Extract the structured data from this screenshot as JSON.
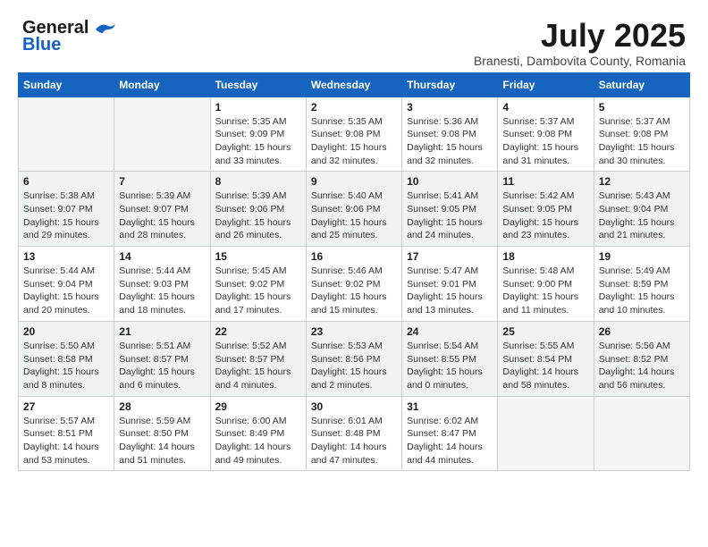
{
  "logo": {
    "line1": "General",
    "line2": "Blue"
  },
  "title": "July 2025",
  "subtitle": "Branesti, Dambovita County, Romania",
  "weekdays": [
    "Sunday",
    "Monday",
    "Tuesday",
    "Wednesday",
    "Thursday",
    "Friday",
    "Saturday"
  ],
  "weeks": [
    [
      {
        "day": "",
        "empty": true
      },
      {
        "day": "",
        "empty": true
      },
      {
        "day": "1",
        "sunrise": "Sunrise: 5:35 AM",
        "sunset": "Sunset: 9:09 PM",
        "daylight": "Daylight: 15 hours and 33 minutes."
      },
      {
        "day": "2",
        "sunrise": "Sunrise: 5:35 AM",
        "sunset": "Sunset: 9:08 PM",
        "daylight": "Daylight: 15 hours and 32 minutes."
      },
      {
        "day": "3",
        "sunrise": "Sunrise: 5:36 AM",
        "sunset": "Sunset: 9:08 PM",
        "daylight": "Daylight: 15 hours and 32 minutes."
      },
      {
        "day": "4",
        "sunrise": "Sunrise: 5:37 AM",
        "sunset": "Sunset: 9:08 PM",
        "daylight": "Daylight: 15 hours and 31 minutes."
      },
      {
        "day": "5",
        "sunrise": "Sunrise: 5:37 AM",
        "sunset": "Sunset: 9:08 PM",
        "daylight": "Daylight: 15 hours and 30 minutes."
      }
    ],
    [
      {
        "day": "6",
        "sunrise": "Sunrise: 5:38 AM",
        "sunset": "Sunset: 9:07 PM",
        "daylight": "Daylight: 15 hours and 29 minutes."
      },
      {
        "day": "7",
        "sunrise": "Sunrise: 5:39 AM",
        "sunset": "Sunset: 9:07 PM",
        "daylight": "Daylight: 15 hours and 28 minutes."
      },
      {
        "day": "8",
        "sunrise": "Sunrise: 5:39 AM",
        "sunset": "Sunset: 9:06 PM",
        "daylight": "Daylight: 15 hours and 26 minutes."
      },
      {
        "day": "9",
        "sunrise": "Sunrise: 5:40 AM",
        "sunset": "Sunset: 9:06 PM",
        "daylight": "Daylight: 15 hours and 25 minutes."
      },
      {
        "day": "10",
        "sunrise": "Sunrise: 5:41 AM",
        "sunset": "Sunset: 9:05 PM",
        "daylight": "Daylight: 15 hours and 24 minutes."
      },
      {
        "day": "11",
        "sunrise": "Sunrise: 5:42 AM",
        "sunset": "Sunset: 9:05 PM",
        "daylight": "Daylight: 15 hours and 23 minutes."
      },
      {
        "day": "12",
        "sunrise": "Sunrise: 5:43 AM",
        "sunset": "Sunset: 9:04 PM",
        "daylight": "Daylight: 15 hours and 21 minutes."
      }
    ],
    [
      {
        "day": "13",
        "sunrise": "Sunrise: 5:44 AM",
        "sunset": "Sunset: 9:04 PM",
        "daylight": "Daylight: 15 hours and 20 minutes."
      },
      {
        "day": "14",
        "sunrise": "Sunrise: 5:44 AM",
        "sunset": "Sunset: 9:03 PM",
        "daylight": "Daylight: 15 hours and 18 minutes."
      },
      {
        "day": "15",
        "sunrise": "Sunrise: 5:45 AM",
        "sunset": "Sunset: 9:02 PM",
        "daylight": "Daylight: 15 hours and 17 minutes."
      },
      {
        "day": "16",
        "sunrise": "Sunrise: 5:46 AM",
        "sunset": "Sunset: 9:02 PM",
        "daylight": "Daylight: 15 hours and 15 minutes."
      },
      {
        "day": "17",
        "sunrise": "Sunrise: 5:47 AM",
        "sunset": "Sunset: 9:01 PM",
        "daylight": "Daylight: 15 hours and 13 minutes."
      },
      {
        "day": "18",
        "sunrise": "Sunrise: 5:48 AM",
        "sunset": "Sunset: 9:00 PM",
        "daylight": "Daylight: 15 hours and 11 minutes."
      },
      {
        "day": "19",
        "sunrise": "Sunrise: 5:49 AM",
        "sunset": "Sunset: 8:59 PM",
        "daylight": "Daylight: 15 hours and 10 minutes."
      }
    ],
    [
      {
        "day": "20",
        "sunrise": "Sunrise: 5:50 AM",
        "sunset": "Sunset: 8:58 PM",
        "daylight": "Daylight: 15 hours and 8 minutes."
      },
      {
        "day": "21",
        "sunrise": "Sunrise: 5:51 AM",
        "sunset": "Sunset: 8:57 PM",
        "daylight": "Daylight: 15 hours and 6 minutes."
      },
      {
        "day": "22",
        "sunrise": "Sunrise: 5:52 AM",
        "sunset": "Sunset: 8:57 PM",
        "daylight": "Daylight: 15 hours and 4 minutes."
      },
      {
        "day": "23",
        "sunrise": "Sunrise: 5:53 AM",
        "sunset": "Sunset: 8:56 PM",
        "daylight": "Daylight: 15 hours and 2 minutes."
      },
      {
        "day": "24",
        "sunrise": "Sunrise: 5:54 AM",
        "sunset": "Sunset: 8:55 PM",
        "daylight": "Daylight: 15 hours and 0 minutes."
      },
      {
        "day": "25",
        "sunrise": "Sunrise: 5:55 AM",
        "sunset": "Sunset: 8:54 PM",
        "daylight": "Daylight: 14 hours and 58 minutes."
      },
      {
        "day": "26",
        "sunrise": "Sunrise: 5:56 AM",
        "sunset": "Sunset: 8:52 PM",
        "daylight": "Daylight: 14 hours and 56 minutes."
      }
    ],
    [
      {
        "day": "27",
        "sunrise": "Sunrise: 5:57 AM",
        "sunset": "Sunset: 8:51 PM",
        "daylight": "Daylight: 14 hours and 53 minutes."
      },
      {
        "day": "28",
        "sunrise": "Sunrise: 5:59 AM",
        "sunset": "Sunset: 8:50 PM",
        "daylight": "Daylight: 14 hours and 51 minutes."
      },
      {
        "day": "29",
        "sunrise": "Sunrise: 6:00 AM",
        "sunset": "Sunset: 8:49 PM",
        "daylight": "Daylight: 14 hours and 49 minutes."
      },
      {
        "day": "30",
        "sunrise": "Sunrise: 6:01 AM",
        "sunset": "Sunset: 8:48 PM",
        "daylight": "Daylight: 14 hours and 47 minutes."
      },
      {
        "day": "31",
        "sunrise": "Sunrise: 6:02 AM",
        "sunset": "Sunset: 8:47 PM",
        "daylight": "Daylight: 14 hours and 44 minutes."
      },
      {
        "day": "",
        "empty": true
      },
      {
        "day": "",
        "empty": true
      }
    ]
  ]
}
